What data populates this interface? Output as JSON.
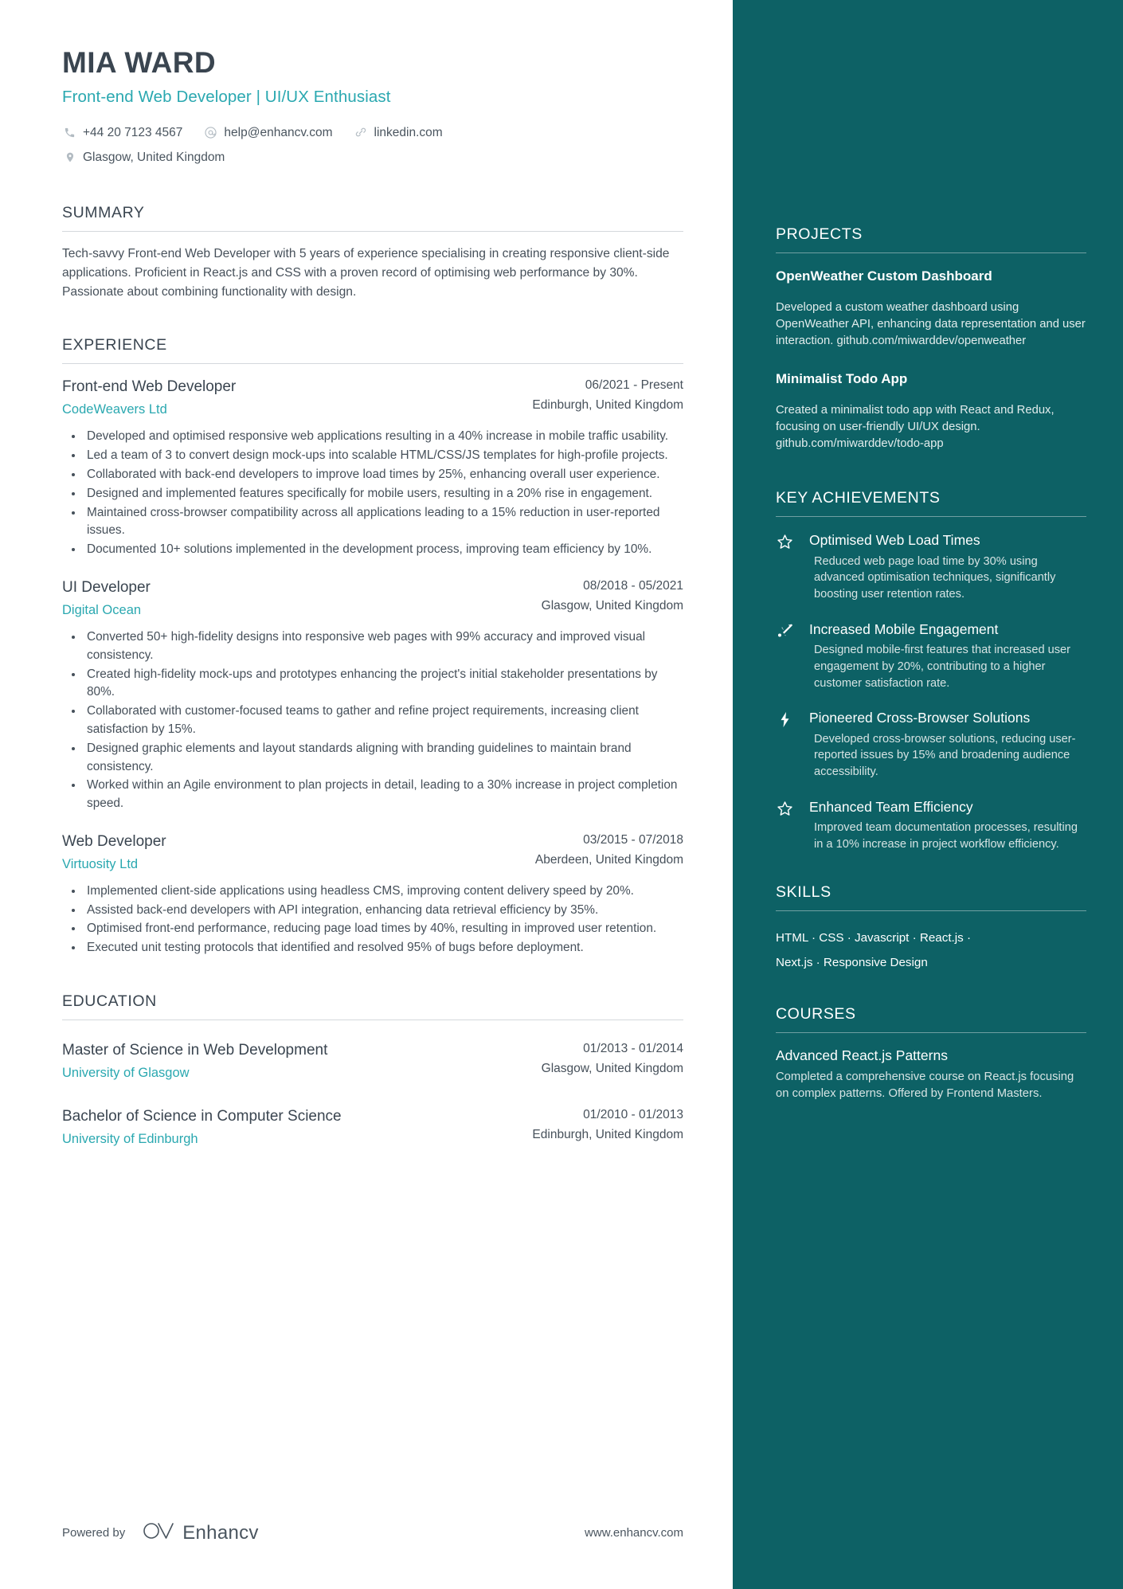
{
  "header": {
    "name": "MIA WARD",
    "headline": "Front-end Web Developer | UI/UX Enthusiast",
    "contacts": [
      {
        "icon": "phone-icon",
        "text": "+44 20 7123 4567"
      },
      {
        "icon": "email-icon",
        "text": "help@enhancv.com"
      },
      {
        "icon": "link-icon",
        "text": "linkedin.com"
      },
      {
        "icon": "location-icon",
        "text": "Glasgow, United Kingdom"
      }
    ]
  },
  "summary": {
    "title": "SUMMARY",
    "text": "Tech-savvy Front-end Web Developer with 5 years of experience specialising in creating responsive client-side applications. Proficient in React.js and CSS with a proven record of optimising web performance by 30%. Passionate about combining functionality with design."
  },
  "experience": {
    "title": "EXPERIENCE",
    "entries": [
      {
        "role": "Front-end Web Developer",
        "company": "CodeWeavers Ltd",
        "date": "06/2021 - Present",
        "location": "Edinburgh, United Kingdom",
        "bullets": [
          "Developed and optimised responsive web applications resulting in a 40% increase in mobile traffic usability.",
          "Led a team of 3 to convert design mock-ups into scalable HTML/CSS/JS templates for high-profile projects.",
          "Collaborated with back-end developers to improve load times by 25%, enhancing overall user experience.",
          "Designed and implemented features specifically for mobile users, resulting in a 20% rise in engagement.",
          "Maintained cross-browser compatibility across all applications leading to a 15% reduction in user-reported issues.",
          "Documented 10+ solutions implemented in the development process, improving team efficiency by 10%."
        ]
      },
      {
        "role": "UI Developer",
        "company": "Digital Ocean",
        "date": "08/2018 - 05/2021",
        "location": "Glasgow, United Kingdom",
        "bullets": [
          "Converted 50+ high-fidelity designs into responsive web pages with 99% accuracy and improved visual consistency.",
          "Created high-fidelity mock-ups and prototypes enhancing the project's initial stakeholder presentations by 80%.",
          "Collaborated with customer-focused teams to gather and refine project requirements, increasing client satisfaction by 15%.",
          "Designed graphic elements and layout standards aligning with branding guidelines to maintain brand consistency.",
          "Worked within an Agile environment to plan projects in detail, leading to a 30% increase in project completion speed."
        ]
      },
      {
        "role": "Web Developer",
        "company": "Virtuosity Ltd",
        "date": "03/2015 - 07/2018",
        "location": "Aberdeen, United Kingdom",
        "bullets": [
          "Implemented client-side applications using headless CMS, improving content delivery speed by 20%.",
          "Assisted back-end developers with API integration, enhancing data retrieval efficiency by 35%.",
          "Optimised front-end performance, reducing page load times by 40%, resulting in improved user retention.",
          "Executed unit testing protocols that identified and resolved 95% of bugs before deployment."
        ]
      }
    ]
  },
  "education": {
    "title": "EDUCATION",
    "entries": [
      {
        "degree": "Master of Science in Web Development",
        "school": "University of Glasgow",
        "date": "01/2013 - 01/2014",
        "location": "Glasgow, United Kingdom"
      },
      {
        "degree": "Bachelor of Science in Computer Science",
        "school": "University of Edinburgh",
        "date": "01/2010 - 01/2013",
        "location": "Edinburgh, United Kingdom"
      }
    ]
  },
  "footer": {
    "powered_by": "Powered by",
    "brand": "Enhancv",
    "url": "www.enhancv.com"
  },
  "sidebar": {
    "projects": {
      "title": "PROJECTS",
      "items": [
        {
          "name": "OpenWeather Custom Dashboard",
          "description": "Developed a custom weather dashboard using OpenWeather API, enhancing data representation and user interaction. github.com/miwarddev/openweather"
        },
        {
          "name": "Minimalist Todo App",
          "description": "Created a minimalist todo app with React and Redux, focusing on user-friendly UI/UX design. github.com/miwarddev/todo-app"
        }
      ]
    },
    "achievements": {
      "title": "KEY ACHIEVEMENTS",
      "items": [
        {
          "icon": "star-icon",
          "title": "Optimised Web Load Times",
          "description": "Reduced web page load time by 30% using advanced optimisation techniques, significantly boosting user retention rates."
        },
        {
          "icon": "rocket-icon",
          "title": "Increased Mobile Engagement",
          "description": "Designed mobile-first features that increased user engagement by 20%, contributing to a higher customer satisfaction rate."
        },
        {
          "icon": "bolt-icon",
          "title": "Pioneered Cross-Browser Solutions",
          "description": "Developed cross-browser solutions, reducing user-reported issues by 15% and broadening audience accessibility."
        },
        {
          "icon": "star-icon",
          "title": "Enhanced Team Efficiency",
          "description": "Improved team documentation processes, resulting in a 10% increase in project workflow efficiency."
        }
      ]
    },
    "skills": {
      "title": "SKILLS",
      "line1": "HTML · CSS · Javascript · React.js ·",
      "line2": "Next.js · Responsive Design"
    },
    "courses": {
      "title": "COURSES",
      "items": [
        {
          "name": "Advanced React.js Patterns",
          "description": "Completed a comprehensive course on React.js focusing on complex patterns. Offered by Frontend Masters."
        }
      ]
    }
  },
  "colors": {
    "sidebar_bg": "#0d6165",
    "accent": "#2aa8b0",
    "text": "#46505a"
  }
}
